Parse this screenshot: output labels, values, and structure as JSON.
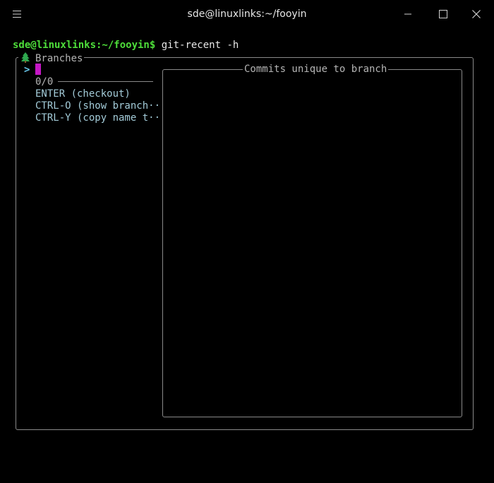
{
  "window": {
    "title": "sde@linuxlinks:~/fooyin",
    "icons": {
      "menu": "hamburger-menu-icon",
      "minimize": "minimize-icon",
      "maximize": "maximize-icon",
      "close": "close-icon"
    }
  },
  "terminal": {
    "prompt": "sde@linuxlinks:~/fooyin$",
    "command": " git-recent -h"
  },
  "branches_panel": {
    "icon": "evergreen-tree-icon",
    "title": "Branches",
    "selector": ">",
    "count": "0/0",
    "help": [
      "ENTER (checkout)",
      "CTRL-O (show branch··",
      "CTRL-Y (copy name t··"
    ]
  },
  "commits_panel": {
    "title": "Commits unique to branch"
  },
  "colors": {
    "prompt": "#4ede3a",
    "selector": "#67c5e8",
    "cursor": "#c517c5",
    "help_text": "#a3cbd8",
    "border": "#8a8a8a"
  }
}
